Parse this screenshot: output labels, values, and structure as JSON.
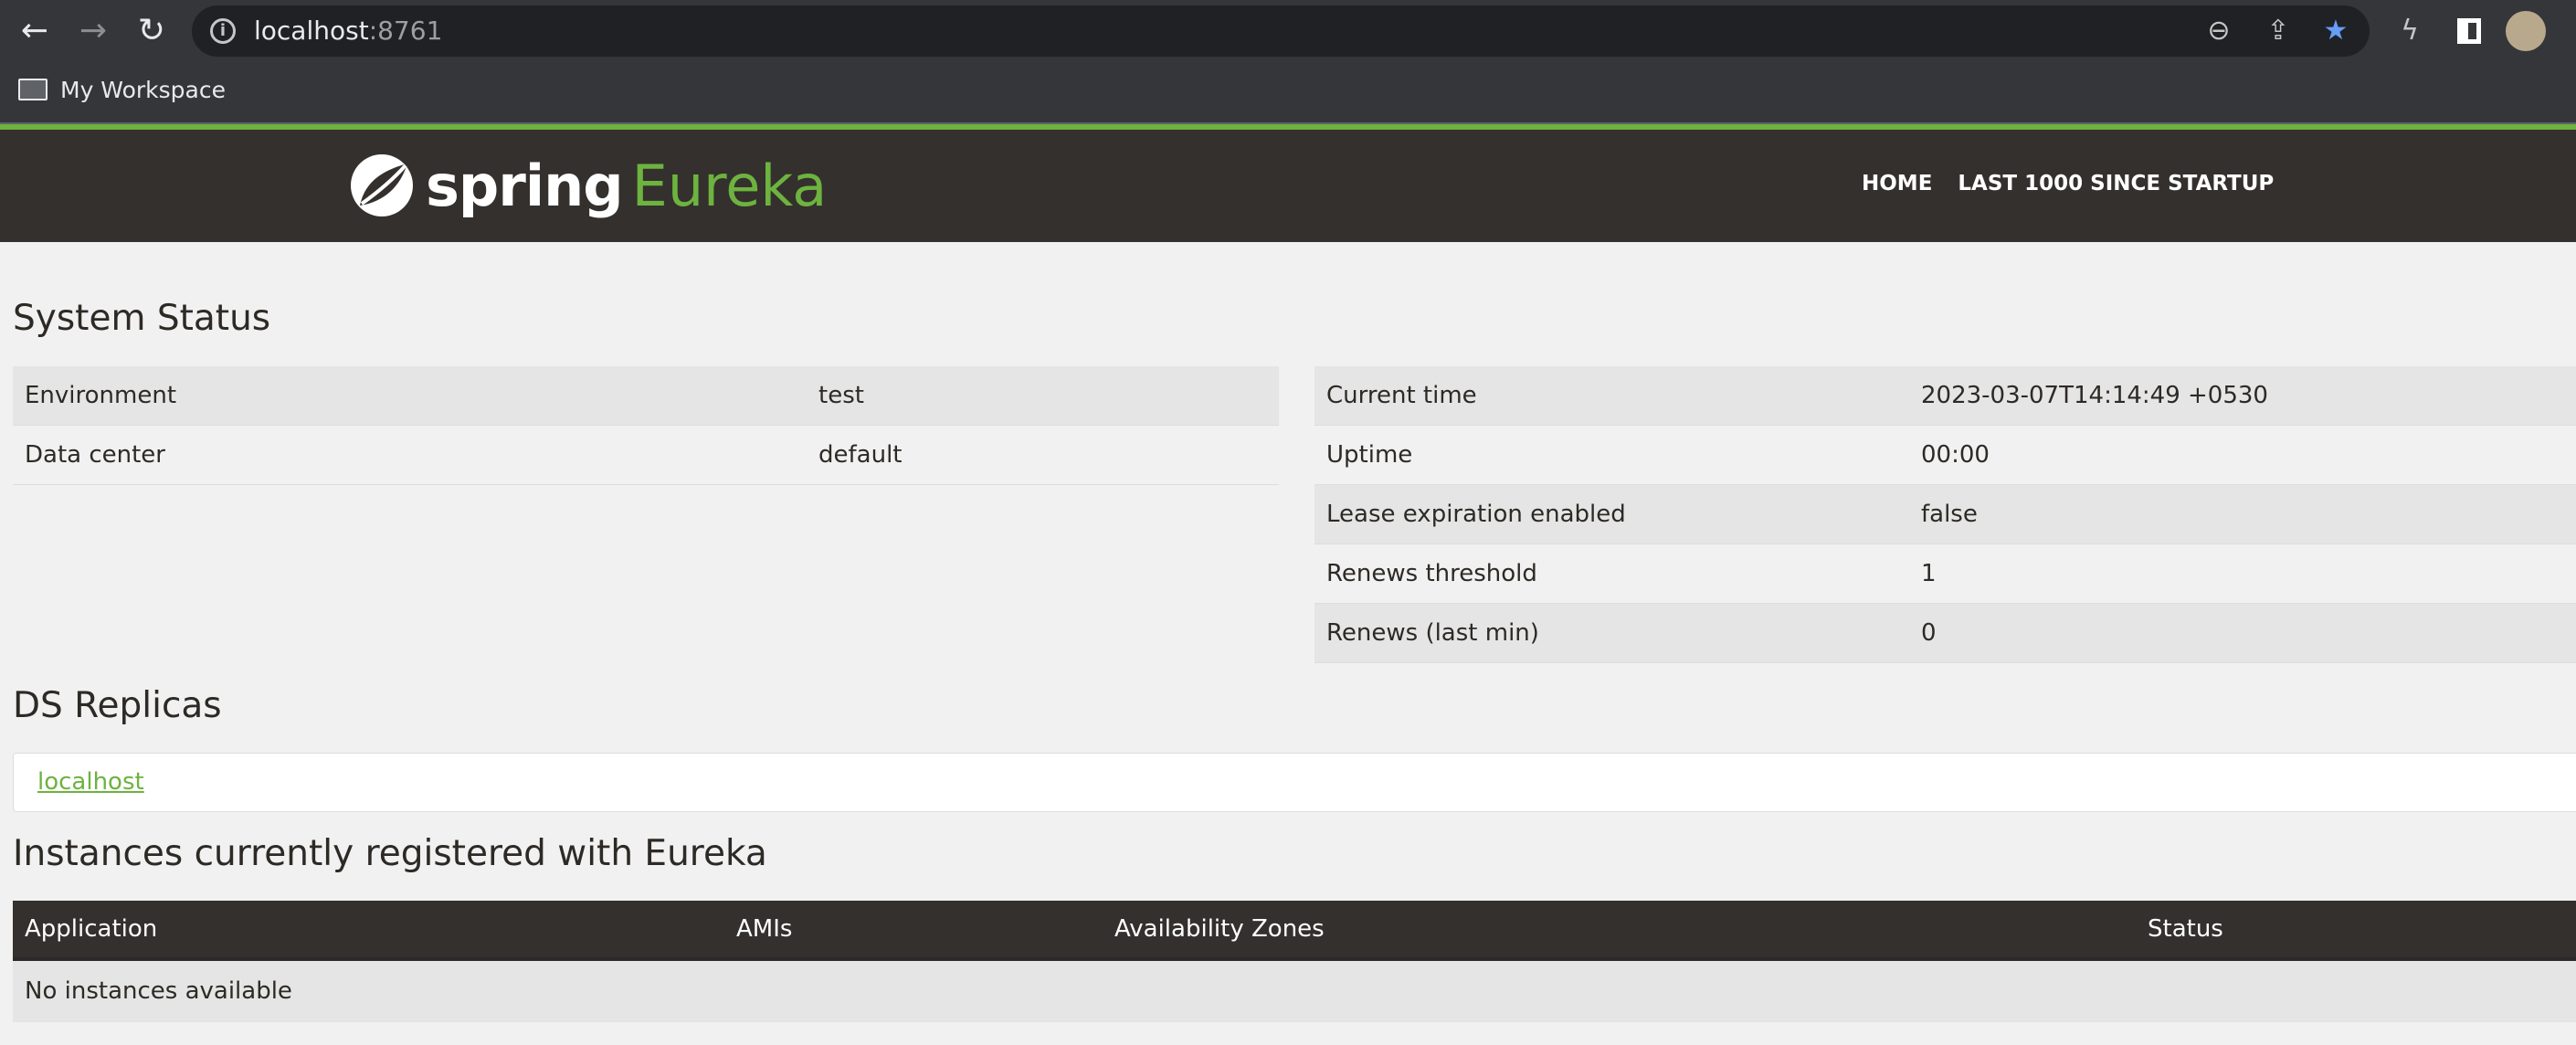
{
  "browser": {
    "url_host": "localhost",
    "url_port": ":8761",
    "bookmark": "My Workspace"
  },
  "header": {
    "logo_text_1": "spring",
    "logo_text_2": "Eureka",
    "nav": [
      "HOME",
      "LAST 1000 SINCE STARTUP"
    ]
  },
  "system_status": {
    "title": "System Status",
    "left": [
      {
        "label": "Environment",
        "value": "test"
      },
      {
        "label": "Data center",
        "value": "default"
      }
    ],
    "right": [
      {
        "label": "Current time",
        "value": "2023-03-07T14:14:49 +0530"
      },
      {
        "label": "Uptime",
        "value": "00:00"
      },
      {
        "label": "Lease expiration enabled",
        "value": "false"
      },
      {
        "label": "Renews threshold",
        "value": "1"
      },
      {
        "label": "Renews (last min)",
        "value": "0"
      }
    ]
  },
  "ds_replicas": {
    "title": "DS Replicas",
    "items": [
      "localhost"
    ]
  },
  "instances": {
    "title": "Instances currently registered with Eureka",
    "columns": [
      "Application",
      "AMIs",
      "Availability Zones",
      "Status"
    ],
    "empty": "No instances available"
  }
}
